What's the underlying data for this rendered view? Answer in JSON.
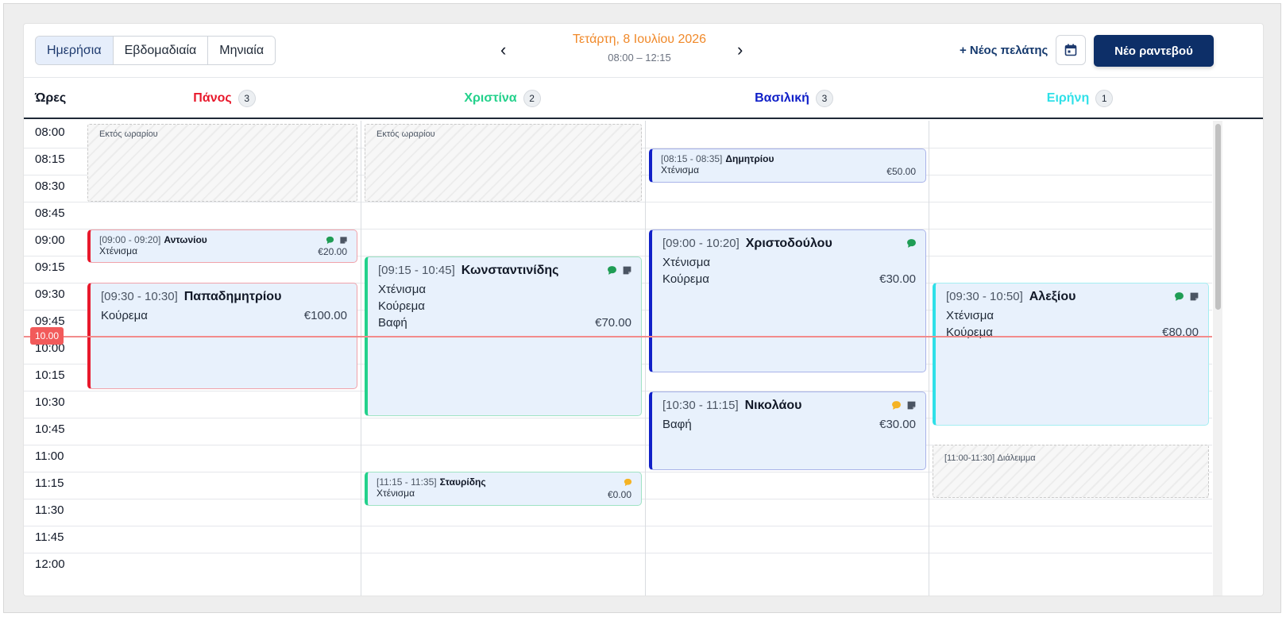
{
  "views": [
    "Ημερήσια",
    "Εβδομαδιαία",
    "Μηνιαία"
  ],
  "active_view": "Ημερήσια",
  "nav": {
    "prev": "‹",
    "next": "›"
  },
  "date": {
    "title": "Τετάρτη, 8 Ιουλίου 2026",
    "range": "08:00 – 12:15"
  },
  "actions": {
    "new_client": "+ Νέος πελάτης",
    "new_appointment": "Νέο ραντεβού",
    "calendar_icon": "calendar-icon"
  },
  "hours_header": "Ώρες",
  "staff": [
    {
      "name": "Πάνος",
      "count": "3",
      "color": "#e8192c"
    },
    {
      "name": "Χριστίνα",
      "count": "2",
      "color": "#23d18b"
    },
    {
      "name": "Βασιλική",
      "count": "3",
      "color": "#1020c8"
    },
    {
      "name": "Ειρήνη",
      "count": "1",
      "color": "#2fe0e8"
    }
  ],
  "times": [
    "08:00",
    "08:15",
    "08:30",
    "08:45",
    "09:00",
    "09:15",
    "09:30",
    "09:45",
    "10:00",
    "10:15",
    "10:30",
    "10:45",
    "11:00",
    "11:15",
    "11:30",
    "11:45",
    "12:00"
  ],
  "off_hours_label": "Εκτός ωραρίου",
  "break": {
    "time": "[11:00-11:30]",
    "label": "Διάλειμμα"
  },
  "now_label": "10.00",
  "appointments": {
    "pano_1": {
      "time": "[09:00 - 09:20]",
      "client": "Αντωνίου",
      "services": [
        "Χτένισμα"
      ],
      "price": "€20.00",
      "icons": [
        "chat-icon-green",
        "note-icon"
      ]
    },
    "pano_2": {
      "time": "[09:30 - 10:30]",
      "client": "Παπαδημητρίου",
      "services": [
        "Κούρεμα"
      ],
      "price": "€100.00",
      "icons": []
    },
    "xristina_1": {
      "time": "[09:15 - 10:45]",
      "client": "Κωνσταντινίδης",
      "services": [
        "Χτένισμα",
        "Κούρεμα",
        "Βαφή"
      ],
      "price": "€70.00",
      "icons": [
        "chat-icon-green",
        "note-icon"
      ]
    },
    "xristina_2": {
      "time": "[11:15 - 11:35]",
      "client": "Σταυρίδης",
      "services": [
        "Χτένισμα"
      ],
      "price": "€0.00",
      "icons": [
        "chat-icon-yellow"
      ]
    },
    "vasiliki_1": {
      "time": "[08:15 - 08:35]",
      "client": "Δημητρίου",
      "services": [
        "Χτένισμα"
      ],
      "price": "€50.00",
      "icons": []
    },
    "vasiliki_2": {
      "time": "[09:00 - 10:20]",
      "client": "Χριστοδούλου",
      "services": [
        "Χτένισμα",
        "Κούρεμα"
      ],
      "price": "€30.00",
      "icons": [
        "chat-icon-green"
      ]
    },
    "vasiliki_3": {
      "time": "[10:30 - 11:15]",
      "client": "Νικολάου",
      "services": [
        "Βαφή"
      ],
      "price": "€30.00",
      "icons": [
        "chat-icon-yellow",
        "note-icon"
      ]
    },
    "eirini_1": {
      "time": "[09:30 - 10:50]",
      "client": "Αλεξίου",
      "services": [
        "Χτένισμα",
        "Κούρεμα"
      ],
      "price": "€80.00",
      "icons": [
        "chat-icon-green",
        "note-icon"
      ]
    }
  },
  "colors": {
    "accent_date": "#f0892a",
    "primary_button": "#0d2f68",
    "now_line": "#f25a5a",
    "chat_green": "#1f9d55",
    "chat_yellow": "#f5b324",
    "note_grey": "#4b5563"
  }
}
